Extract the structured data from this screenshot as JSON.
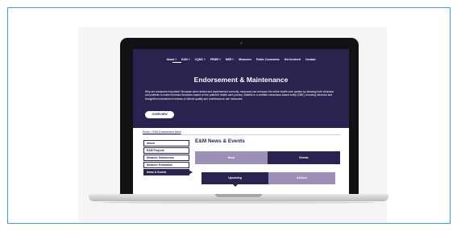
{
  "nav": {
    "items": [
      "About ˅",
      "E&M ˅",
      "CQMC ˅",
      "PRMR ˅",
      "MSR ˅",
      "Measures",
      "Public Comments",
      "Get Involved",
      "Contact"
    ]
  },
  "hero": {
    "title": "Endorsement & Maintenance",
    "body": "Why are measures important? Because when tested and implemented correctly, measures can enhance the entire health care system by allowing both clinicians and patients to make informed decisions based on the patient's health care journey. Battelle is a certified consensus-based entity (CBE), ensuring informed and thoughtful endorsement reviews of clinical quality and cost/resource use measures.",
    "button": "OVERVIEW"
  },
  "breadcrumb": "Home > E&M Endorsement Maint",
  "sidebar": {
    "items": [
      "About",
      "E&M Projects",
      "Measure Submission",
      "Measure Evaluation",
      "News & Events"
    ]
  },
  "main": {
    "title": "E&M News & Events",
    "tabs": [
      "News",
      "Events"
    ],
    "subtabs": [
      "Upcoming",
      "Archive"
    ]
  },
  "colors": {
    "brand_dark": "#2c2250",
    "brand_light": "#9d8fb6",
    "frame_border": "#3fa0d8"
  }
}
